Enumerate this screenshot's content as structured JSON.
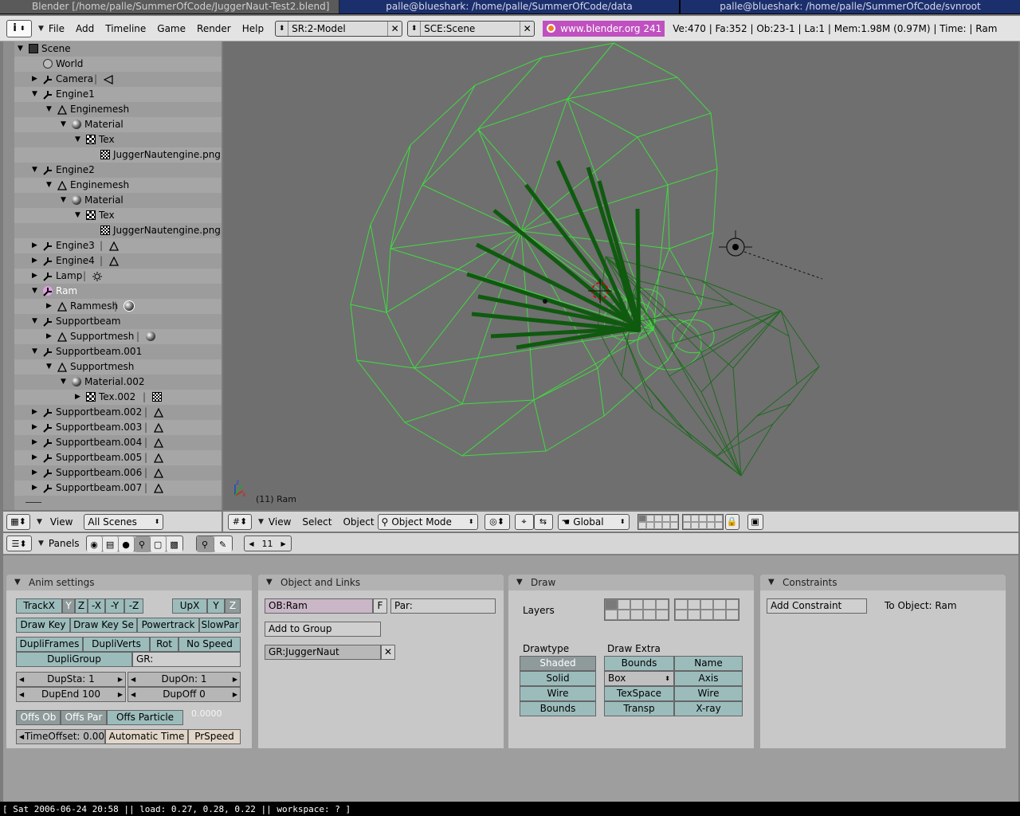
{
  "titlebar": {
    "blender": "Blender [/home/palle/SummerOfCode/JuggerNaut-Test2.blend]",
    "term1": "palle@blueshark: /home/palle/SummerOfCode/data",
    "term2": "palle@blueshark: /home/palle/SummerOfCode/svnroot"
  },
  "info": {
    "menus": [
      "File",
      "Add",
      "Timeline",
      "Game",
      "Render",
      "Help"
    ],
    "screen_field": "SR:2-Model",
    "scene_field": "SCE:Scene",
    "link": "www.blender.org 241",
    "stats": "Ve:470 | Fa:352 | Ob:23-1 | La:1  | Mem:1.98M (0.97M)  | Time: | Ram"
  },
  "outliner": {
    "rows": [
      {
        "label": "Scene"
      },
      {
        "label": "World"
      },
      {
        "label": "Camera"
      },
      {
        "label": "Engine1"
      },
      {
        "label": "Enginemesh"
      },
      {
        "label": "Material"
      },
      {
        "label": "Tex"
      },
      {
        "label": "JuggerNautengine.png"
      },
      {
        "label": "Engine2"
      },
      {
        "label": "Enginemesh"
      },
      {
        "label": "Material"
      },
      {
        "label": "Tex"
      },
      {
        "label": "JuggerNautengine.png"
      },
      {
        "label": "Engine3"
      },
      {
        "label": "Engine4"
      },
      {
        "label": "Lamp"
      },
      {
        "label": "Ram"
      },
      {
        "label": "Rammesh"
      },
      {
        "label": "Supportbeam"
      },
      {
        "label": "Supportmesh"
      },
      {
        "label": "Supportbeam.001"
      },
      {
        "label": "Supportmesh"
      },
      {
        "label": "Material.002"
      },
      {
        "label": "Tex.002"
      },
      {
        "label": "Supportbeam.002"
      },
      {
        "label": "Supportbeam.003"
      },
      {
        "label": "Supportbeam.004"
      },
      {
        "label": "Supportbeam.005"
      },
      {
        "label": "Supportbeam.006"
      },
      {
        "label": "Supportbeam.007"
      }
    ],
    "header": {
      "view_menu": "View",
      "scenes_select": "All Scenes"
    }
  },
  "viewport": {
    "object_label": "(11) Ram",
    "header": {
      "menus": [
        "View",
        "Select",
        "Object"
      ],
      "mode": "Object Mode",
      "orientation": "Global"
    }
  },
  "buttons_header": {
    "panels_label": "Panels",
    "frame": "11"
  },
  "panels": {
    "anim": {
      "title": "Anim settings",
      "trackx": "TrackX",
      "y": "Y",
      "z": "Z",
      "nx": "-X",
      "ny": "-Y",
      "nz": "-Z",
      "upx": "UpX",
      "upy": "Y",
      "upz": "Z",
      "drawkey": "Draw Key",
      "drawkeysel": "Draw Key Se",
      "powertrack": "Powertrack",
      "slowpar": "SlowPar",
      "dupliframes": "DupliFrames",
      "dupliverts": "DupliVerts",
      "rot": "Rot",
      "nospeed": "No Speed",
      "dupligroup": "DupliGroup",
      "gr": "GR:",
      "dupsta": "DupSta: 1",
      "dupon": "DupOn: 1",
      "dupend": "DupEnd 100",
      "dupoff": "DupOff 0",
      "offsob": "Offs Ob",
      "offspar": "Offs Par",
      "offsparticle": "Offs Particle",
      "offsval": "0.0000",
      "timeoffset": "TimeOffset: 0.00",
      "autotime": "Automatic Time",
      "prspeed": "PrSpeed"
    },
    "objlinks": {
      "title": "Object and Links",
      "ob": "OB:Ram",
      "f": "F",
      "par": "Par:",
      "addgroup": "Add to Group",
      "group": "GR:JuggerNaut"
    },
    "draw": {
      "title": "Draw",
      "layers": "Layers",
      "drawtype": "Drawtype",
      "drawextra": "Draw Extra",
      "shaded": "Shaded",
      "solid": "Solid",
      "wire": "Wire",
      "bounds": "Bounds",
      "ex_bounds": "Bounds",
      "ex_name": "Name",
      "ex_box": "Box",
      "ex_axis": "Axis",
      "ex_texspace": "TexSpace",
      "ex_wire": "Wire",
      "ex_transp": "Transp",
      "ex_xray": "X-ray"
    },
    "constraints": {
      "title": "Constraints",
      "add": "Add Constraint",
      "toobject": "To Object: Ram"
    }
  },
  "statusbar": "[ Sat 2006-06-24 20:58 || load: 0.27, 0.28, 0.22 || workspace: ? ]",
  "colors": {
    "wire_light": "#3fdc3f",
    "wire_dark": "#1f7a1f",
    "selected_dark": "#0d4f0d",
    "viewport_bg": "#6f6f6f"
  }
}
